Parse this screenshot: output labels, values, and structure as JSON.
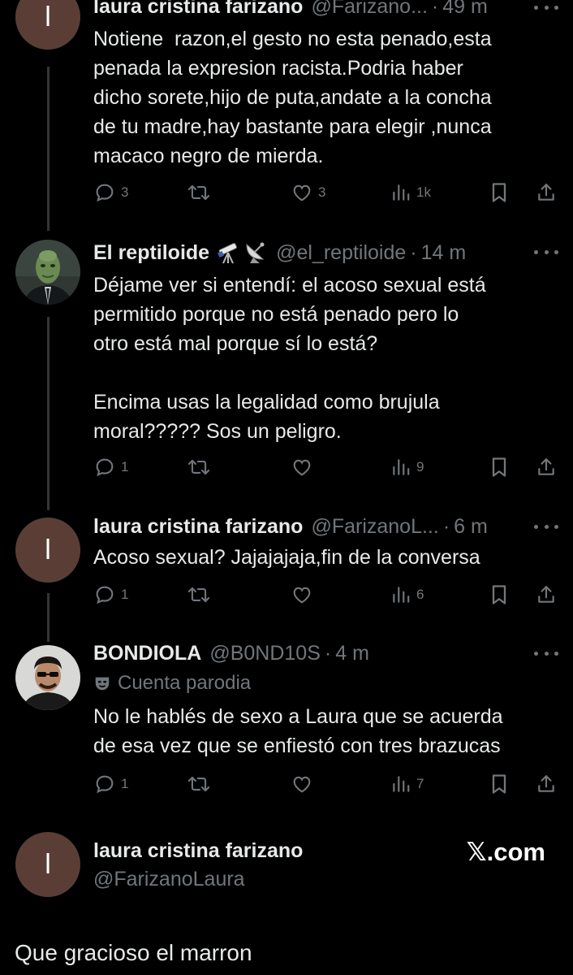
{
  "tweets": [
    {
      "avatar_letter": "l",
      "name": "laura cristina farizano",
      "handle": "@Farizano...",
      "time": "49 m",
      "text": "Notiene  razon,el gesto no esta penado,esta\npenada la expresion racista.Podria haber\ndicho sorete,hijo de puta,andate a la concha\nde tu madre,hay bastante para elegir ,nunca\nmacaco negro de mierda.",
      "replies": "3",
      "retweets": "",
      "likes": "3",
      "views": "1k"
    },
    {
      "name": "El reptiloide",
      "emoji_icons": [
        "telescope-icon",
        "satellite-antenna-icon"
      ],
      "handle": "@el_reptiloide",
      "time": "14 m",
      "text": "Déjame ver si entendí: el acoso sexual está\npermitido porque no está penado pero lo\notro está mal porque sí lo está?\n\nEncima usas la legalidad como brujula\nmoral????? Sos un peligro.",
      "replies": "1",
      "retweets": "",
      "likes": "",
      "views": "9"
    },
    {
      "avatar_letter": "l",
      "name": "laura cristina farizano",
      "handle": "@FarizanoL...",
      "time": "6 m",
      "text": "Acoso sexual? Jajajajaja,fin de la conversa",
      "replies": "1",
      "retweets": "",
      "likes": "",
      "views": "6"
    },
    {
      "name": "BONDIOLA",
      "handle": "@B0ND10S",
      "time": "4 m",
      "parody_label": "Cuenta parodia",
      "text": "No le hablés de sexo a Laura que se acuerda\nde esa vez que se enfiestó con tres brazucas",
      "replies": "1",
      "retweets": "",
      "likes": "",
      "views": "7"
    }
  ],
  "quote_card": {
    "avatar_letter": "l",
    "name": "laura cristina farizano",
    "handle": "@FarizanoLaura",
    "brand": "𝕏.com"
  },
  "caption": "Que gracioso el marron",
  "colors": {
    "background": "#000000",
    "text": "#e7e9ea",
    "muted": "#71767b",
    "avatar_brown": "#5a3e36",
    "thread_line": "#333639"
  }
}
